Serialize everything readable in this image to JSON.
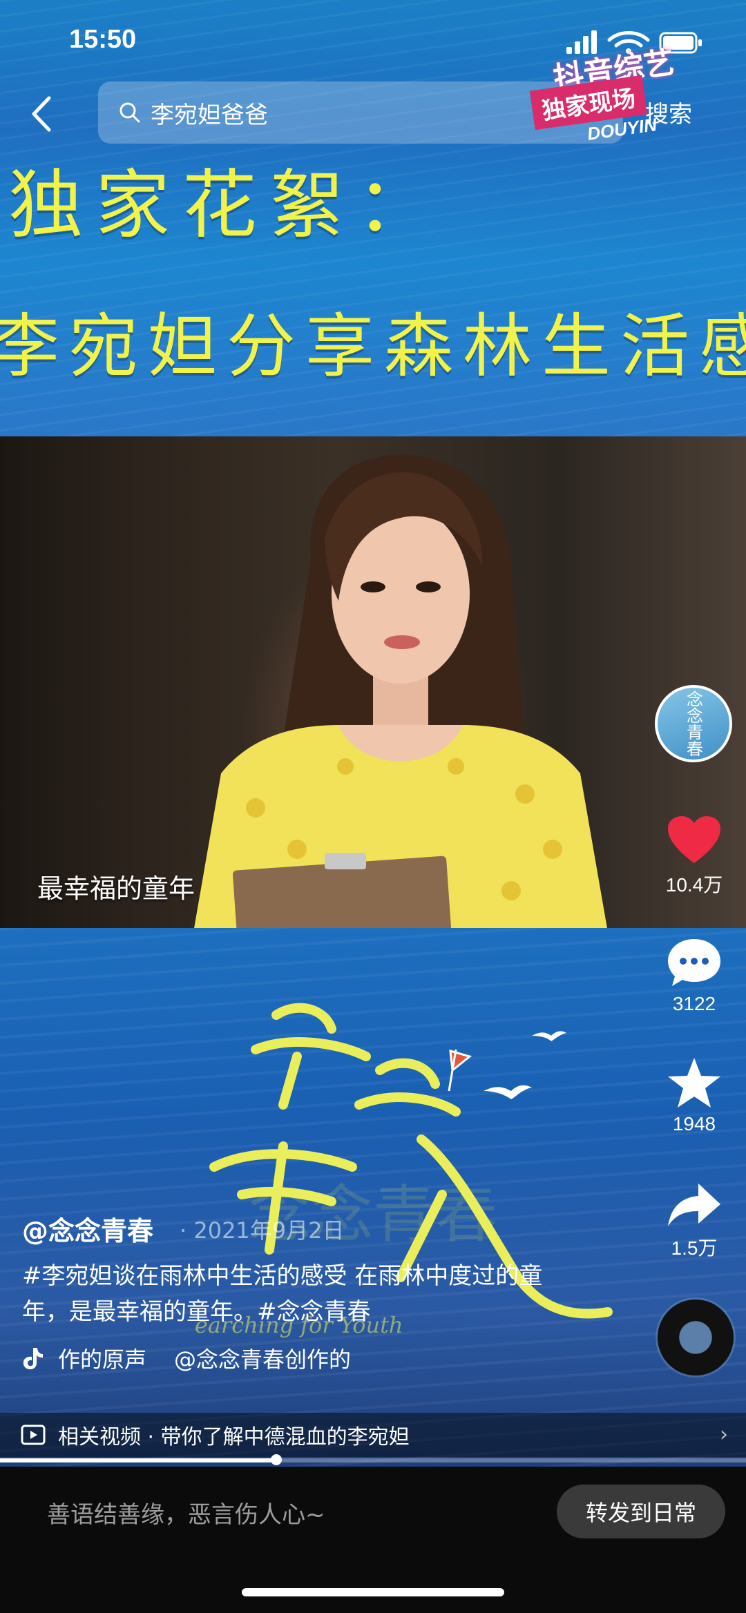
{
  "status_bar": {
    "time": "15:50"
  },
  "header": {
    "search_query": "李宛妲爸爸",
    "search_button": "搜索",
    "badge": {
      "line1": "抖音综艺",
      "line2": "独家现场",
      "line3": "DOUYIN"
    }
  },
  "banner": {
    "line1": "独家花絮：",
    "line2": "李宛妲分享森林生活感受"
  },
  "video": {
    "subtitle": "最幸福的童年"
  },
  "show_logo": {
    "title": "念念青春",
    "subtitle": "Searching for Youth"
  },
  "rail": {
    "avatar_text": "念念青春",
    "likes": "10.4万",
    "comments": "3122",
    "favorites": "1948",
    "shares": "1.5万"
  },
  "caption": {
    "author": "@念念青春",
    "date": "· 2021年9月2日",
    "description": "#李宛妲谈在雨林中生活的感受 在雨林中度过的童年，是最幸福的童年。#念念青春",
    "music_left": "作的原声",
    "music_right": "@念念青春创作的"
  },
  "related": {
    "text": "相关视频 · 带你了解中德混血的李宛妲"
  },
  "progress": 0.37,
  "bottom": {
    "comment_placeholder": "善语结善缘，恶言伤人心~",
    "share_button": "转发到日常"
  },
  "colors": {
    "banner_text": "#f1f24a",
    "like_heart": "#ee2a45"
  }
}
